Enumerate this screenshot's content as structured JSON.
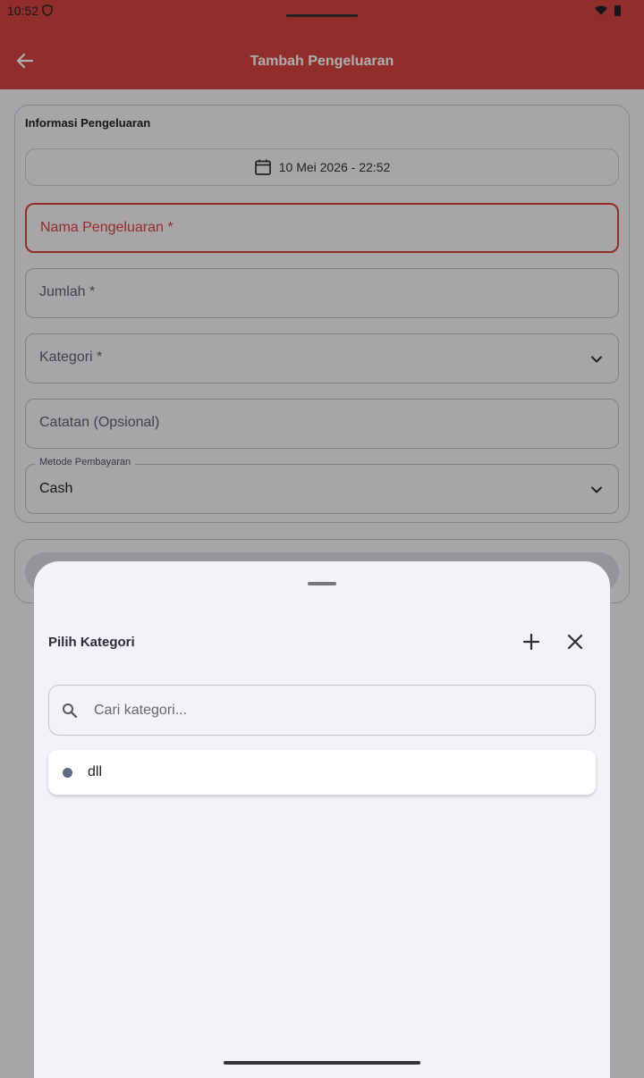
{
  "status_bar": {
    "time": "10:52"
  },
  "appbar": {
    "title": "Tambah Pengeluaran"
  },
  "form": {
    "section_title": "Informasi Pengeluaran",
    "date": "10 Mei 2026 - 22:52",
    "fields": {
      "name_label": "Nama Pengeluaran *",
      "amount_label": "Jumlah *",
      "category_label": "Kategori *",
      "notes_label": "Catatan (Opsional)",
      "payment_label": "Metode Pembayaran",
      "payment_value": "Cash"
    }
  },
  "sheet": {
    "title": "Pilih Kategori",
    "search_placeholder": "Cari kategori...",
    "items": [
      {
        "label": "dll",
        "color": "#5d6c84"
      }
    ]
  },
  "colors": {
    "primary": "#d64541",
    "sheet_bg": "#f5f1f8"
  }
}
